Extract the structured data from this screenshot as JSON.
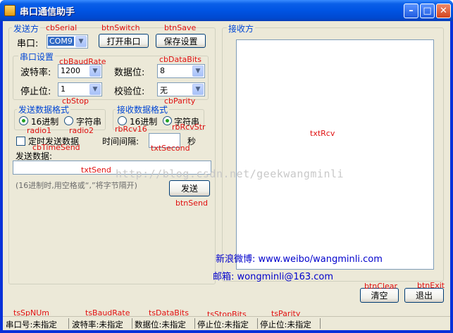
{
  "window": {
    "title": "串口通信助手"
  },
  "send_group": {
    "title": "发送方",
    "port_label": "串口:",
    "port_value": "COM9",
    "open_button": "打开串口",
    "save_button": "保存设置"
  },
  "serial_settings": {
    "title": "串口设置",
    "baud_label": "波特率:",
    "baud_value": "1200",
    "databits_label": "数据位:",
    "databits_value": "8",
    "stopbits_label": "停止位:",
    "stopbits_value": "1",
    "parity_label": "校验位:",
    "parity_value": "无"
  },
  "send_format": {
    "title": "发送数据格式",
    "hex": "16进制",
    "string": "字符串"
  },
  "recv_format": {
    "title": "接收数据格式",
    "hex": "16进制",
    "string": "字符串"
  },
  "timed_send": {
    "label": "定时发送数据",
    "interval_label": "时间间隔:",
    "unit": "秒"
  },
  "send_data": {
    "label": "发送数据:",
    "hint": "(16进制时,用空格或“,”将字节隔开)",
    "send_button": "发送"
  },
  "recv_group": {
    "title": "接收方",
    "weibo": "新浪微博: www.weibo/wangminli.com",
    "email": "邮箱: wongminli@163.com"
  },
  "buttons": {
    "clear": "清空",
    "exit": "退出"
  },
  "watermark": "http://blog.csdn.net/geekwangminli",
  "status": {
    "port": "串口号:未指定",
    "baud": "波特率:未指定",
    "databits": "数据位:未指定",
    "stopbits": "停止位:未指定",
    "parity": "停止位:未指定"
  },
  "annotations": {
    "cbSerial": "cbSerial",
    "btnSwitch": "btnSwitch",
    "btnSave": "btnSave",
    "cbBaudRate": "cbBaudRate",
    "cbDataBits": "cbDataBits",
    "cbStop": "cbStop",
    "cbParity": "cbParity",
    "radio1": "radio1",
    "radio2": "radio2",
    "rbRcv16": "rbRcv16",
    "rbRcvStr": "rbRcvStr",
    "cbTimeSend": "cbTimeSend",
    "txtSecond": "txtSecond",
    "txtSend": "txtSend",
    "btnSend": "btnSend",
    "txtRcv": "txtRcv",
    "btnClear": "btnClear",
    "btnExit": "btnExit",
    "tsSpNUm": "tsSpNUm",
    "tsBaudRate": "tsBaudRate",
    "tsDataBits": "tsDataBits",
    "tsStopBits": "tsStopBits",
    "tsParity": "tsParity"
  },
  "colors": {
    "title_bar": "#0054e3",
    "group_title": "#0046d5",
    "annotation": "#e01010",
    "link_text": "#0000cc",
    "face": "#ece9d8"
  }
}
